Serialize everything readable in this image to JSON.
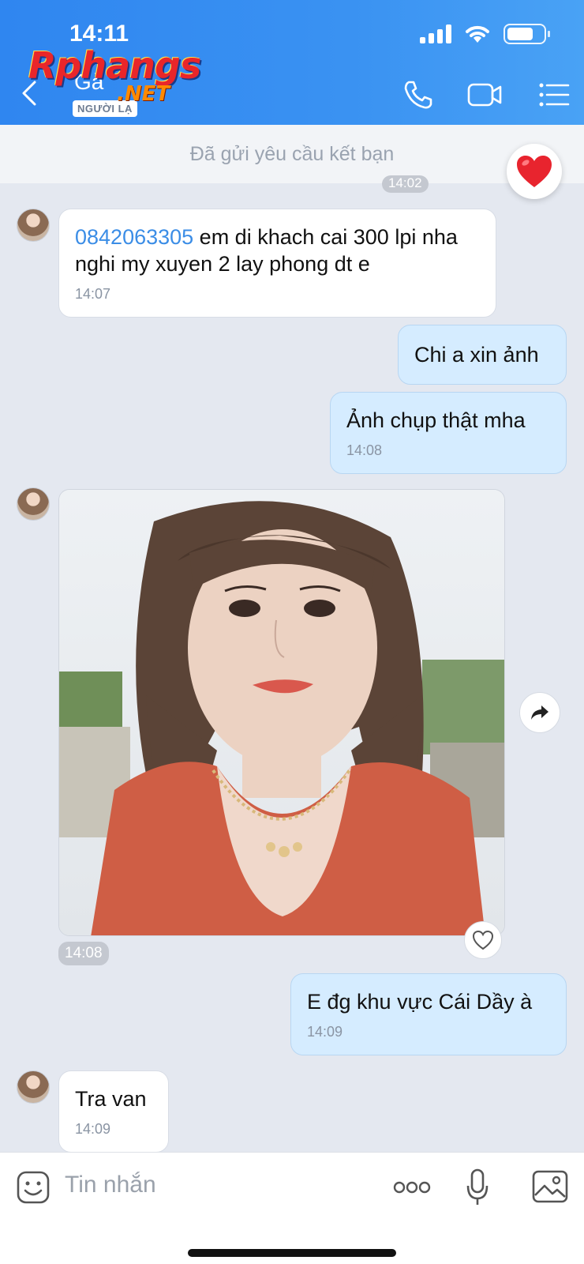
{
  "status": {
    "time": "14:11"
  },
  "header": {
    "contact_name": "Gà",
    "stranger_badge": "NGƯỜI LẠ",
    "watermark": "Rphangs",
    "watermark_suffix": ".NET"
  },
  "friend_request": {
    "text": "Đã gửi yêu cầu kết bạn",
    "partial_time": "14:02"
  },
  "messages": [
    {
      "direction": "in",
      "phone": "0842063305",
      "text": " em di khach cai 300 lpi nha nghi my xuyen 2 lay phong dt e",
      "time": "14:07"
    },
    {
      "direction": "out",
      "text": "Chi a xin ảnh",
      "time": ""
    },
    {
      "direction": "out",
      "text": "Ảnh chụp thật mha",
      "time": "14:08"
    },
    {
      "direction": "in",
      "type": "photo",
      "time": "14:08"
    },
    {
      "direction": "out",
      "text": "E đg khu vực Cái Dầy à",
      "time": "14:09"
    },
    {
      "direction": "in",
      "text": "Tra van",
      "time": "14:09"
    }
  ],
  "input": {
    "placeholder": "Tin nhắn"
  },
  "colors": {
    "header": "#2f86f0",
    "out_bubble": "#d5ecff",
    "in_bubble": "#ffffff",
    "link": "#3b8de6",
    "background": "#e4e8f0"
  },
  "icons": [
    "back-icon",
    "phone-icon",
    "video-icon",
    "menu-icon",
    "heart-icon",
    "share-icon",
    "like-heart-icon",
    "sticker-icon",
    "more-icon",
    "mic-icon",
    "image-icon"
  ]
}
